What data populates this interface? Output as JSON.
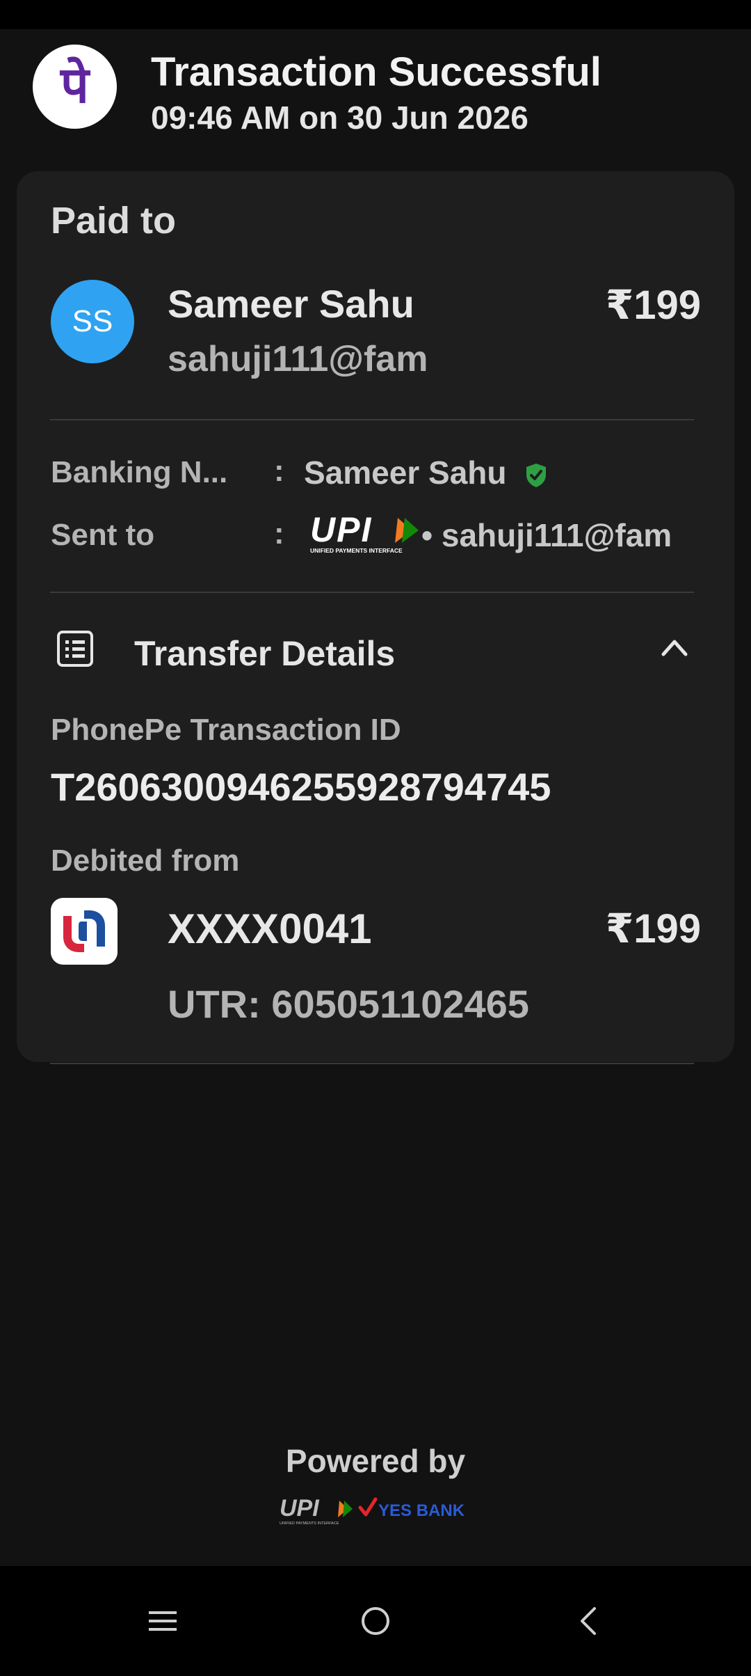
{
  "header": {
    "logo_glyph": "पे",
    "title": "Transaction Successful",
    "timestamp": "09:46 AM on 30 Jun 2026"
  },
  "payee": {
    "section_label": "Paid to",
    "avatar_initials": "SS",
    "name": "Sameer Sahu",
    "upi_id": "sahuji111@fam",
    "amount": "₹199"
  },
  "info_rows": {
    "banking_name_label": "Banking N...",
    "banking_name_value": "Sameer Sahu",
    "sent_to_label": "Sent to",
    "sent_to_value": "• sahuji111@fam",
    "colon": ":"
  },
  "transfer_details": {
    "title": "Transfer Details",
    "txn_id_label": "PhonePe Transaction ID",
    "txn_id_value": "T2606300946255928794745",
    "debited_from_label": "Debited from",
    "account": "XXXX0041",
    "account_amount": "₹199",
    "utr": "UTR: 605051102465"
  },
  "footer": {
    "powered_by": "Powered by",
    "bank_name": "YES BANK"
  },
  "logos": {
    "upi_text": "UPI",
    "upi_tagline": "UNIFIED PAYMENTS INTERFACE"
  },
  "colors": {
    "phonepe_purple": "#5f259f",
    "avatar_blue": "#2fa3f1",
    "verified_green": "#2ea043",
    "card_bg": "#1e1e1f",
    "page_bg": "#121212",
    "union_red": "#d7263d",
    "union_blue": "#1d4fa0"
  },
  "icons": {
    "verified": "shield-check-icon",
    "details": "receipt-list-icon",
    "collapse": "chevron-up-icon",
    "nav_menu": "menu-icon",
    "nav_home": "home-circle-icon",
    "nav_back": "back-chevron-icon"
  }
}
